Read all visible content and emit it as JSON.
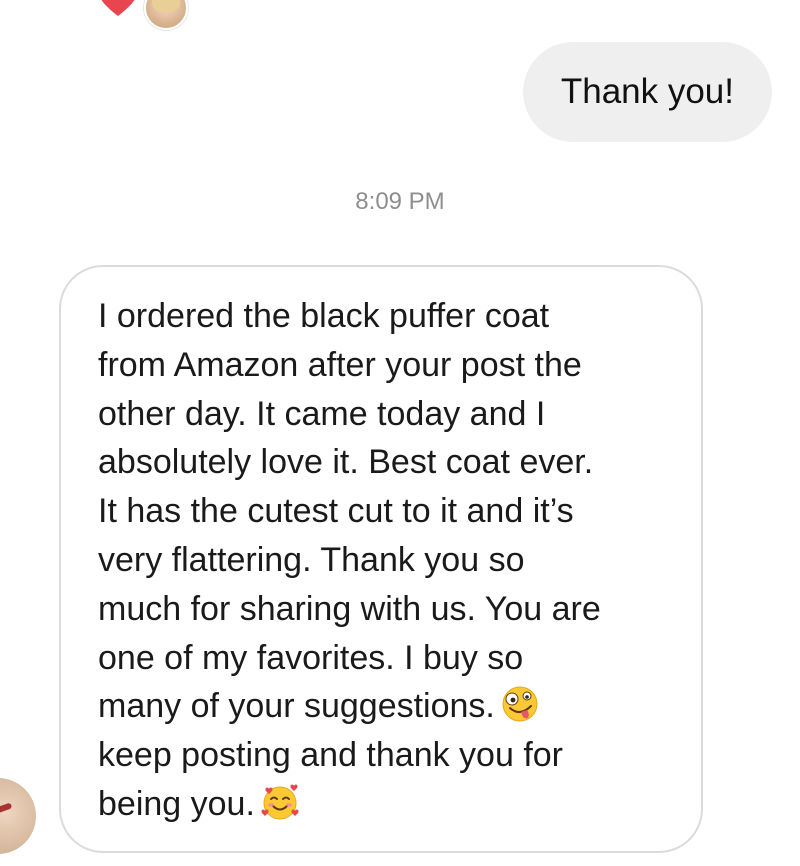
{
  "reaction": {
    "icon": "heart-icon",
    "color": "#e8454f",
    "avatar": "reactor-avatar"
  },
  "messages": {
    "outgoing": {
      "text": "Thank you!",
      "bubble_color": "#efefef"
    },
    "timestamp": "8:09 PM",
    "incoming": {
      "lines": [
        "I ordered the black puffer coat",
        "from Amazon after your post the",
        "other day. It came today and I",
        "absolutely love it. Best coat ever.",
        "It has the cutest cut to it and it’s",
        "very flattering. Thank you so",
        "much for sharing with us. You are",
        "one of my favorites. I buy so",
        "many of your suggestions.",
        "keep posting and  thank you for",
        "being you."
      ],
      "emojis": [
        "zany-face-emoji",
        "smiling-face-with-hearts-emoji"
      ]
    }
  },
  "sender": {
    "avatar": "sender-avatar"
  }
}
